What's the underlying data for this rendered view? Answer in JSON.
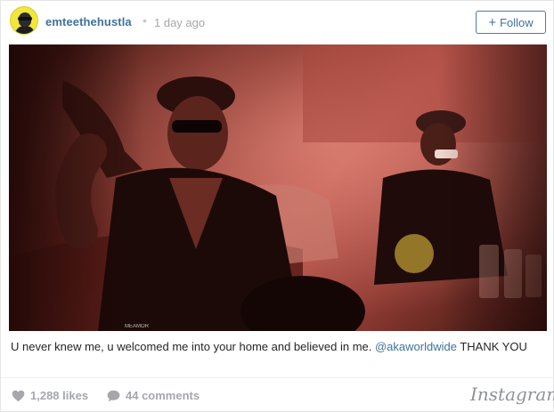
{
  "post": {
    "username": "emteethehustla",
    "separator": "•",
    "timestamp": "1 day ago",
    "follow_label": "Follow",
    "follow_plus": "+"
  },
  "caption": {
    "text_before": "U never knew me, u welcomed me into your home and believed in me. ",
    "mention": "@akaworldwide",
    "text_after": " THANK YOU"
  },
  "footer": {
    "likes": "1,288 likes",
    "comments": "44 comments",
    "brand": "Instagram"
  },
  "photo_watermark": "MEAMOR",
  "colors": {
    "link": "#3f729b",
    "muted": "#a5a7aa",
    "avatar_bg": "#f3e63a"
  },
  "icons": {
    "like": "heart-icon",
    "comment": "speech-bubble-icon"
  }
}
